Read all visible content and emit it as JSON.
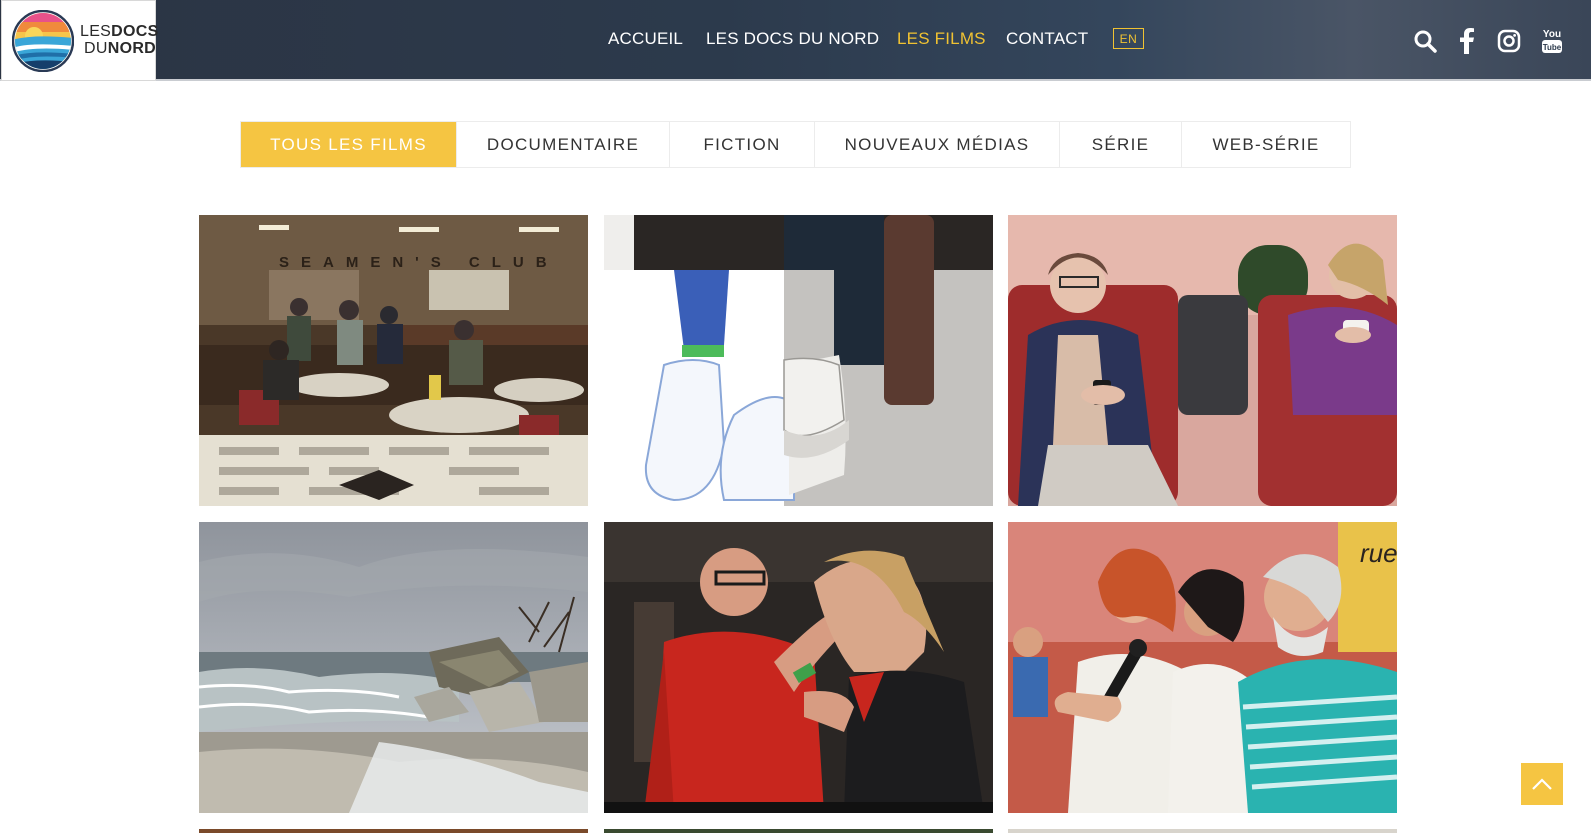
{
  "header": {
    "logo": {
      "line1_a": "LES",
      "line1_b": "DOCS",
      "line2_a": "DU",
      "line2_b": "NORD"
    },
    "nav": [
      {
        "label": "ACCUEIL",
        "active": false
      },
      {
        "label": "LES DOCS DU NORD",
        "active": false
      },
      {
        "label": "LES FILMS",
        "active": true
      },
      {
        "label": "CONTACT",
        "active": false
      }
    ],
    "lang_label": "EN",
    "social": [
      "search-icon",
      "facebook-icon",
      "instagram-icon",
      "youtube-icon"
    ],
    "youtube_label": {
      "top": "You",
      "bottom": "Tube"
    }
  },
  "filters": [
    {
      "label": "TOUS LES FILMS",
      "active": true
    },
    {
      "label": "DOCUMENTAIRE",
      "active": false
    },
    {
      "label": "FICTION",
      "active": false
    },
    {
      "label": "NOUVEAUX MÉDIAS",
      "active": false
    },
    {
      "label": "SÉRIE",
      "active": false
    },
    {
      "label": "WEB-SÉRIE",
      "active": false
    }
  ],
  "films": [
    {
      "scene": "seamen-club-cafe",
      "sign_text": "SEAMEN'S CLUB"
    },
    {
      "scene": "sneakers-drawing"
    },
    {
      "scene": "elderly-women-armchairs"
    },
    {
      "scene": "stormy-beach-debris"
    },
    {
      "scene": "boxing-coach"
    },
    {
      "scene": "singers-microphone",
      "sign_text": "rue"
    }
  ],
  "colors": {
    "accent": "#f5c542",
    "nav_active": "#f0c232",
    "header_bg": "#2c3a4c"
  }
}
